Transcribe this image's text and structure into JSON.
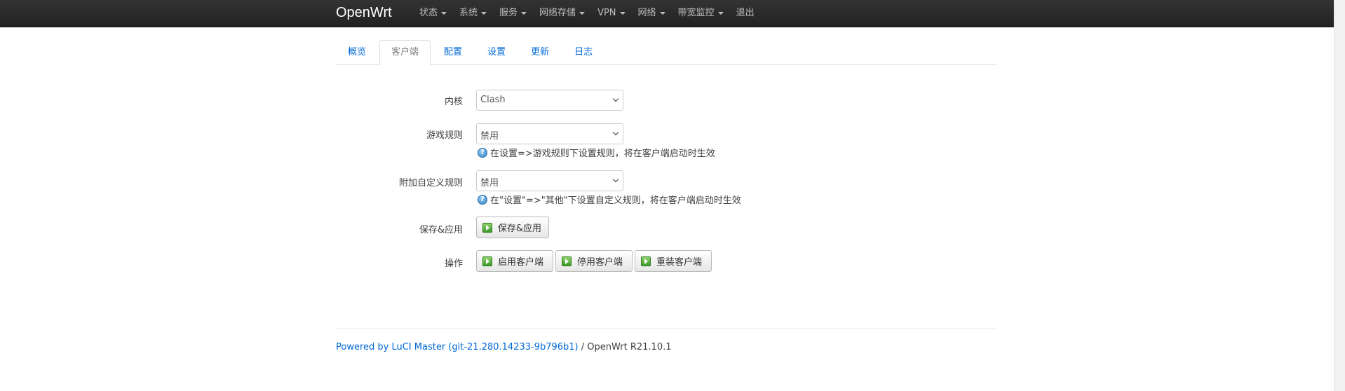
{
  "app": {
    "brand": "OpenWrt"
  },
  "menu": [
    {
      "label": "状态",
      "dropdown": true
    },
    {
      "label": "系统",
      "dropdown": true
    },
    {
      "label": "服务",
      "dropdown": true
    },
    {
      "label": "网络存储",
      "dropdown": true
    },
    {
      "label": "VPN",
      "dropdown": true
    },
    {
      "label": "网络",
      "dropdown": true
    },
    {
      "label": "带宽监控",
      "dropdown": true
    },
    {
      "label": "退出",
      "dropdown": false
    }
  ],
  "tabs": [
    {
      "label": "概览",
      "active": false
    },
    {
      "label": "客户端",
      "active": true
    },
    {
      "label": "配置",
      "active": false
    },
    {
      "label": "设置",
      "active": false
    },
    {
      "label": "更新",
      "active": false
    },
    {
      "label": "日志",
      "active": false
    }
  ],
  "form": {
    "core": {
      "label": "内核",
      "value": "Clash"
    },
    "game_rules": {
      "label": "游戏规则",
      "value": "禁用",
      "hint": "在设置=>游戏规则下设置规则，将在客户端启动时生效"
    },
    "custom_rules": {
      "label": "附加自定义规则",
      "value": "禁用",
      "hint": "在\"设置\"=>\"其他\"下设置自定义规则，将在客户端启动时生效"
    },
    "save": {
      "label": "保存&应用",
      "button": "保存&应用"
    },
    "actions": {
      "label": "操作",
      "start": "启用客户端",
      "stop": "停用客户端",
      "reinstall": "重装客户端"
    }
  },
  "footer": {
    "link": "Powered by LuCI Master (git-21.280.14233-9b796b1)",
    "separator": " / ",
    "version": "OpenWrt R21.10.1"
  },
  "colors": {
    "topbar": "#222222",
    "link": "#0069d6",
    "menu_text": "#bfbfbf"
  }
}
